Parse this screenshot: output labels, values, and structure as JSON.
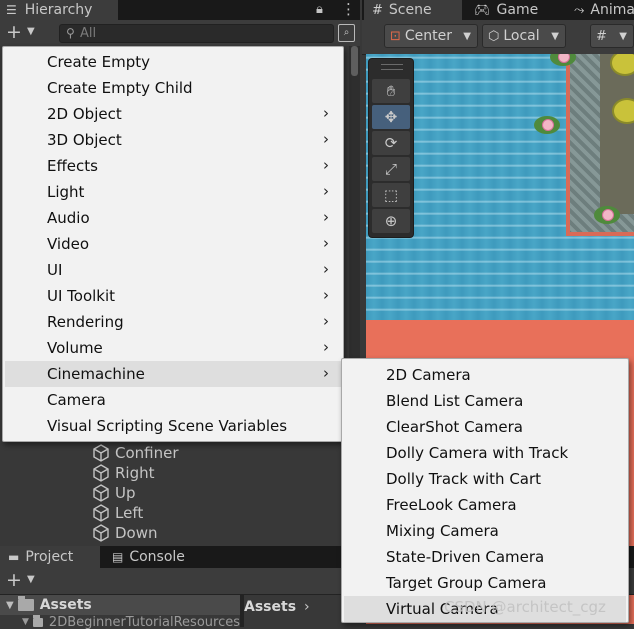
{
  "hierarchy": {
    "tab_label": "Hierarchy",
    "tab_icon": "list-icon",
    "search_placeholder": "All",
    "tree_items": [
      "Confiner",
      "Right",
      "Up",
      "Left",
      "Down"
    ]
  },
  "scene": {
    "tabs": [
      {
        "label": "Scene",
        "icon": "grid-icon"
      },
      {
        "label": "Game",
        "icon": "gamepad-icon"
      },
      {
        "label": "Animat",
        "icon": "animation-icon"
      }
    ],
    "pivot_mode": "Center",
    "pivot_rotation": "Local",
    "tools": [
      "hand-tool",
      "move-tool",
      "rotate-tool",
      "scale-tool",
      "rect-tool",
      "transform-tool"
    ],
    "active_tool": "move-tool"
  },
  "context_menu": {
    "items": [
      {
        "label": "Create Empty",
        "submenu": false
      },
      {
        "label": "Create Empty Child",
        "submenu": false
      },
      {
        "label": "2D Object",
        "submenu": true
      },
      {
        "label": "3D Object",
        "submenu": true
      },
      {
        "label": "Effects",
        "submenu": true
      },
      {
        "label": "Light",
        "submenu": true
      },
      {
        "label": "Audio",
        "submenu": true
      },
      {
        "label": "Video",
        "submenu": true
      },
      {
        "label": "UI",
        "submenu": true
      },
      {
        "label": "UI Toolkit",
        "submenu": true
      },
      {
        "label": "Rendering",
        "submenu": true
      },
      {
        "label": "Volume",
        "submenu": true
      },
      {
        "label": "Cinemachine",
        "submenu": true
      },
      {
        "label": "Camera",
        "submenu": false
      },
      {
        "label": "Visual Scripting Scene Variables",
        "submenu": false
      }
    ],
    "highlighted": "Cinemachine"
  },
  "cinemachine_submenu": {
    "items": [
      "2D Camera",
      "Blend List Camera",
      "ClearShot Camera",
      "Dolly Camera with Track",
      "Dolly Track with Cart",
      "FreeLook Camera",
      "Mixing Camera",
      "State-Driven Camera",
      "Target Group Camera",
      "Virtual Camera"
    ],
    "highlighted": "Virtual Camera"
  },
  "project": {
    "tabs": [
      {
        "label": "Project",
        "icon": "folder-icon"
      },
      {
        "label": "Console",
        "icon": "console-icon"
      }
    ],
    "root_folder": "Assets",
    "sub_folder": "2DBeginnerTutorialResources",
    "breadcrumb": "Assets"
  },
  "watermark": "CSDN @architect_cgz",
  "colors": {
    "menu_bg": "#f2f2f2",
    "menu_highlight": "#dedede",
    "editor_bg": "#383838",
    "tab_bar": "#191919",
    "water": "#49a6c7",
    "sand": "#e8705a"
  }
}
